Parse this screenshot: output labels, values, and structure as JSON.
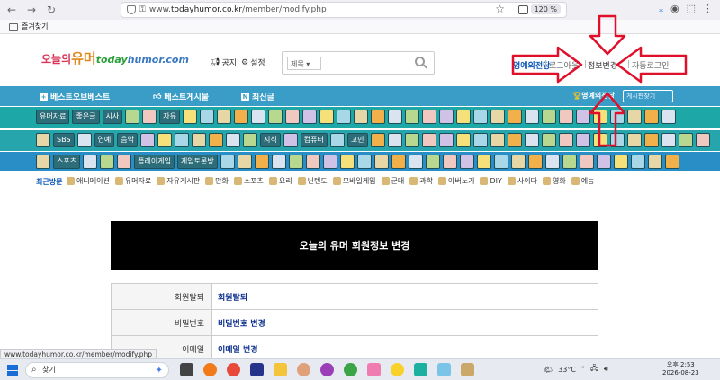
{
  "browser": {
    "url_prefix": "www.",
    "url_domain": "todayhumor.co.kr",
    "url_path": "/member/modify.php",
    "zoom": "120 %",
    "bookmarks_folder": "즐겨찾기"
  },
  "site": {
    "logo_ko1": "오늘의",
    "logo_ko2": "유머",
    "logo_en1": "today",
    "logo_en2": "humor.com",
    "notice_label": "공지",
    "settings_label": "설정",
    "search_select": "제목 ▾",
    "honor_label": "명예의전당",
    "login_label": "로그아웃",
    "modify_label": "정보변경",
    "autologin_label": "자동로그인"
  },
  "nav": {
    "best_of_best": "베스트오브베스트",
    "best_board": "베스트게시물",
    "new_posts": "최신글",
    "honor_btn": "명예의전당",
    "board_search": "게시판찾기",
    "row1_labels": [
      "유머자료",
      "좋은글",
      "시사",
      "자유"
    ],
    "row2_labels": [
      "SBS",
      "연예",
      "음악",
      "지식",
      "컴퓨터",
      "고민"
    ],
    "row3_labels": [
      "스포츠",
      "플레이게임",
      "게임토론방"
    ]
  },
  "recent": {
    "label": "최근방문",
    "items": [
      "애니메이션",
      "유머자료",
      "자유게시판",
      "만화",
      "스포츠",
      "요리",
      "닌텐도",
      "모바일게임",
      "군대",
      "과학",
      "아버노기",
      "DIY",
      "사이다",
      "영화",
      "예능"
    ]
  },
  "main": {
    "title": "오늘의 유머 회원정보 변경",
    "rows": [
      {
        "key": "회원탈퇴",
        "value": "회원탈퇴"
      },
      {
        "key": "비밀번호",
        "value": "비밀번호 변경"
      },
      {
        "key": "이메일",
        "value": "이메일 변경"
      }
    ]
  },
  "status_url": "www.todayhumor.co.kr/member/modify.php",
  "taskbar": {
    "search_placeholder": "찾기",
    "temperature": "33°C",
    "time": "오후 2:53",
    "date": "2026-08-23"
  }
}
